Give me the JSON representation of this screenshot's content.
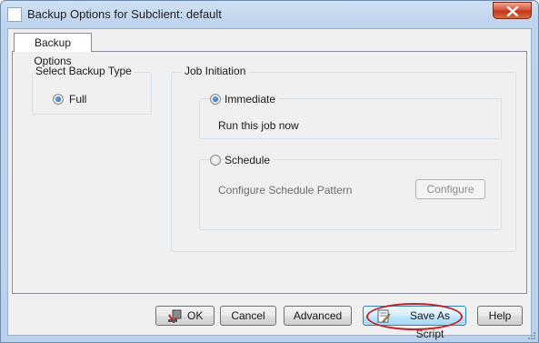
{
  "window": {
    "title": "Backup Options for Subclient: default"
  },
  "tabs": [
    {
      "label": "Backup Options",
      "selected": true
    }
  ],
  "backup_type": {
    "group_label": "Select Backup Type",
    "options": [
      {
        "label": "Full",
        "checked": true
      }
    ]
  },
  "job_initiation": {
    "group_label": "Job Initiation",
    "immediate": {
      "label": "Immediate",
      "checked": true,
      "description": "Run this job now"
    },
    "schedule": {
      "label": "Schedule",
      "checked": false,
      "description": "Configure Schedule Pattern",
      "configure_label": "Configure"
    }
  },
  "footer": {
    "ok_label": "OK",
    "cancel_label": "Cancel",
    "advanced_label": "Advanced",
    "save_as_script_label": "Save As Script",
    "help_label": "Help"
  },
  "icons": {
    "app": "window-icon",
    "close": "close-icon",
    "ok": "ok-icon",
    "save_script": "script-icon"
  },
  "colors": {
    "title_gradient": "#bcd3ec",
    "close_button": "#c2361a",
    "highlight_ring": "#c0242a",
    "focus_border": "#3c7fb1"
  }
}
